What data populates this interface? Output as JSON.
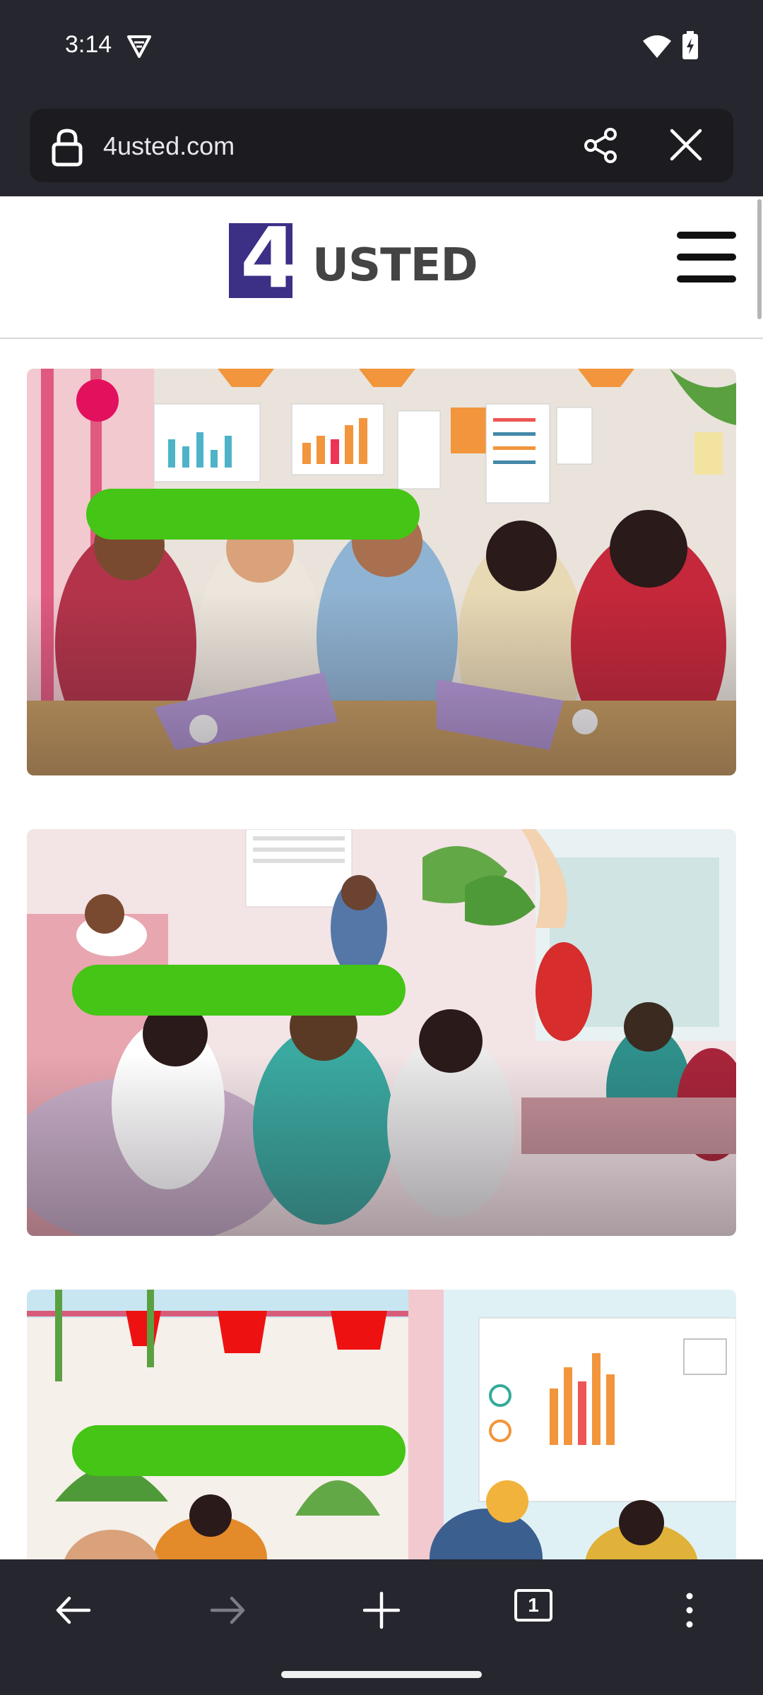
{
  "status_bar": {
    "time": "3:14",
    "icons": [
      "vpn-icon",
      "wifi-icon",
      "battery-charging-icon"
    ]
  },
  "url_bar": {
    "url": "4usted.com",
    "icons": [
      "lock-icon",
      "share-icon",
      "close-icon"
    ]
  },
  "site": {
    "logo_mark": "4",
    "logo_text": "USTED",
    "menu_icon": "hamburger-menu-icon",
    "brand_color": "#3b2f86"
  },
  "articles": [
    {
      "image": "illustration: diverse team working with phones and laptops in front of dashboard charts",
      "title_highlight_color": "#45c515"
    },
    {
      "image": "illustration: people using phones at home, in a living room with plants and a runner outside",
      "title_highlight_color": "#45c515"
    },
    {
      "image": "illustration: office with plants and a whiteboard of analytics charts",
      "title_highlight_color": "#45c515"
    }
  ],
  "bottom_nav": {
    "tab_count": "1",
    "icons": [
      "back-arrow-icon",
      "forward-arrow-icon",
      "new-tab-plus-icon",
      "tab-switcher-icon",
      "more-options-icon"
    ]
  }
}
